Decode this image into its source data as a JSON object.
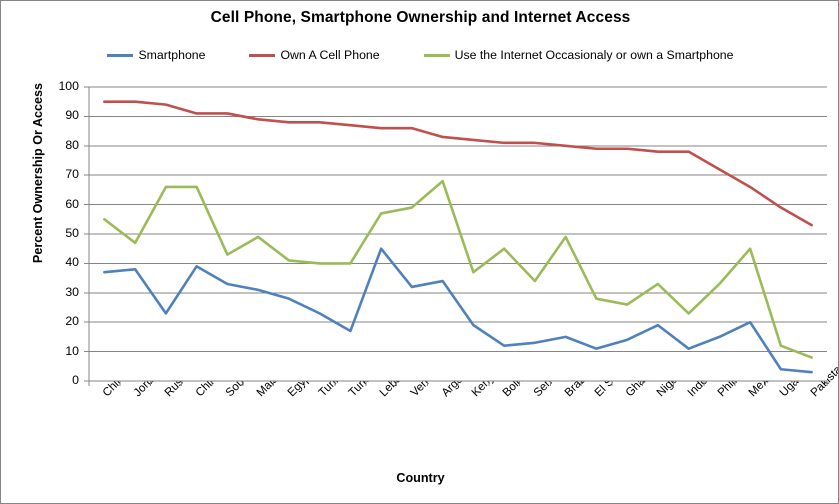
{
  "chart_data": {
    "type": "line",
    "title": "Cell Phone, Smartphone Ownership and Internet Access",
    "xlabel": "Country",
    "ylabel": "Percent Ownership Or Access",
    "ylim": [
      0,
      100
    ],
    "ytick_step": 10,
    "grid": true,
    "legend_position": "top",
    "categories": [
      "China",
      "Jordan",
      "Russia",
      "Chile",
      "South Africa",
      "Malaysia",
      "Egypt",
      "Tunisia",
      "Turkey",
      "Lebanon",
      "Venezuela",
      "Argentina",
      "Kenya",
      "Bolivia",
      "Senegal",
      "Brazil",
      "El Salvador",
      "Ghana",
      "Nigeria",
      "Indonesia",
      "Phillippines",
      "Mexico",
      "Uganda",
      "Pakistan"
    ],
    "yticks": [
      "0",
      "10",
      "20",
      "30",
      "40",
      "50",
      "60",
      "70",
      "80",
      "90",
      "100"
    ],
    "series": [
      {
        "name": "Smartphone",
        "color": "#4F81BD",
        "values": [
          37,
          38,
          23,
          39,
          33,
          31,
          28,
          23,
          17,
          45,
          32,
          34,
          19,
          12,
          13,
          15,
          11,
          14,
          19,
          11,
          15,
          20,
          4,
          3
        ]
      },
      {
        "name": "Own A Cell Phone",
        "color": "#C0504D",
        "values": [
          95,
          95,
          94,
          91,
          91,
          89,
          88,
          88,
          87,
          86,
          86,
          83,
          82,
          81,
          81,
          80,
          79,
          79,
          78,
          78,
          72,
          66,
          59,
          53
        ]
      },
      {
        "name": "Use the Internet Occasionaly or own a Smartphone",
        "color": "#9BBB59",
        "values": [
          55,
          47,
          66,
          66,
          43,
          49,
          41,
          40,
          40,
          57,
          59,
          68,
          37,
          45,
          34,
          49,
          28,
          26,
          33,
          23,
          33,
          45,
          12,
          8
        ]
      }
    ]
  }
}
